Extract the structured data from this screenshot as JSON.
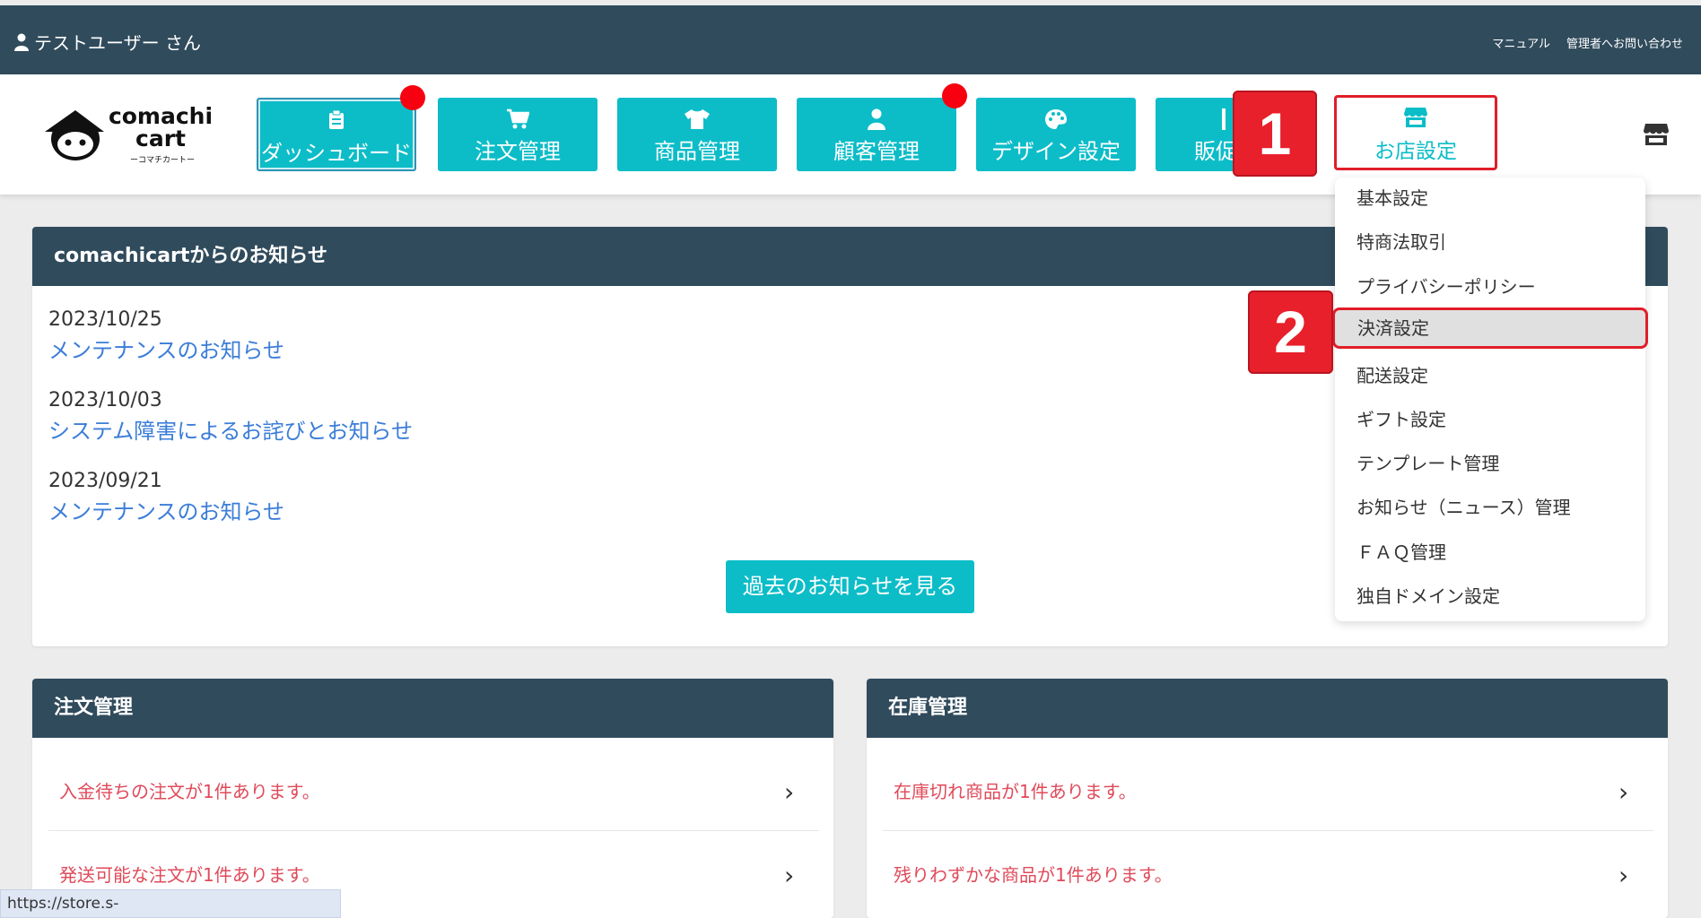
{
  "topbar": {
    "user_label": "テストユーザー さん",
    "manual_link": "マニュアル",
    "contact_link": "管理者へお問い合わせ"
  },
  "logo": {
    "line1": "comachi",
    "line2": "cart",
    "sub": "ーコマチカートー"
  },
  "nav": {
    "dashboard": "ダッシュボード",
    "orders": "注文管理",
    "products": "商品管理",
    "customers": "顧客管理",
    "design": "デザイン設定",
    "sales": "販促",
    "store": "お店設定"
  },
  "steps": {
    "one": "1",
    "two": "2"
  },
  "news": {
    "title": "comachicartからのお知らせ",
    "items": [
      {
        "date": "2023/10/25",
        "title": "メンテナンスのお知らせ"
      },
      {
        "date": "2023/10/03",
        "title": "システム障害によるお詫びとお知らせ"
      },
      {
        "date": "2023/09/21",
        "title": "メンテナンスのお知らせ"
      }
    ],
    "more_button": "過去のお知らせを見る"
  },
  "orders_panel": {
    "title": "注文管理",
    "rows": [
      "入金待ちの注文が1件あります。",
      "発送可能な注文が1件あります。"
    ]
  },
  "stock_panel": {
    "title": "在庫管理",
    "rows": [
      "在庫切れ商品が1件あります。",
      "残りわずかな商品が1件あります。"
    ]
  },
  "store_menu": {
    "items": [
      "基本設定",
      "特商法取引",
      "プライバシーポリシー",
      "決済設定",
      "配送設定",
      "ギフト設定",
      "テンプレート管理",
      "お知らせ（ニュース）管理",
      "ＦＡＱ管理",
      "独自ドメイン設定"
    ]
  },
  "status_url": "https://store.s-flyingfox.com/store/settlement",
  "colors": {
    "header": "#304b5c",
    "accent": "#0cbdc8",
    "highlight": "#e01e29",
    "alert_text": "#e04a5a",
    "link": "#3b7dd8"
  }
}
